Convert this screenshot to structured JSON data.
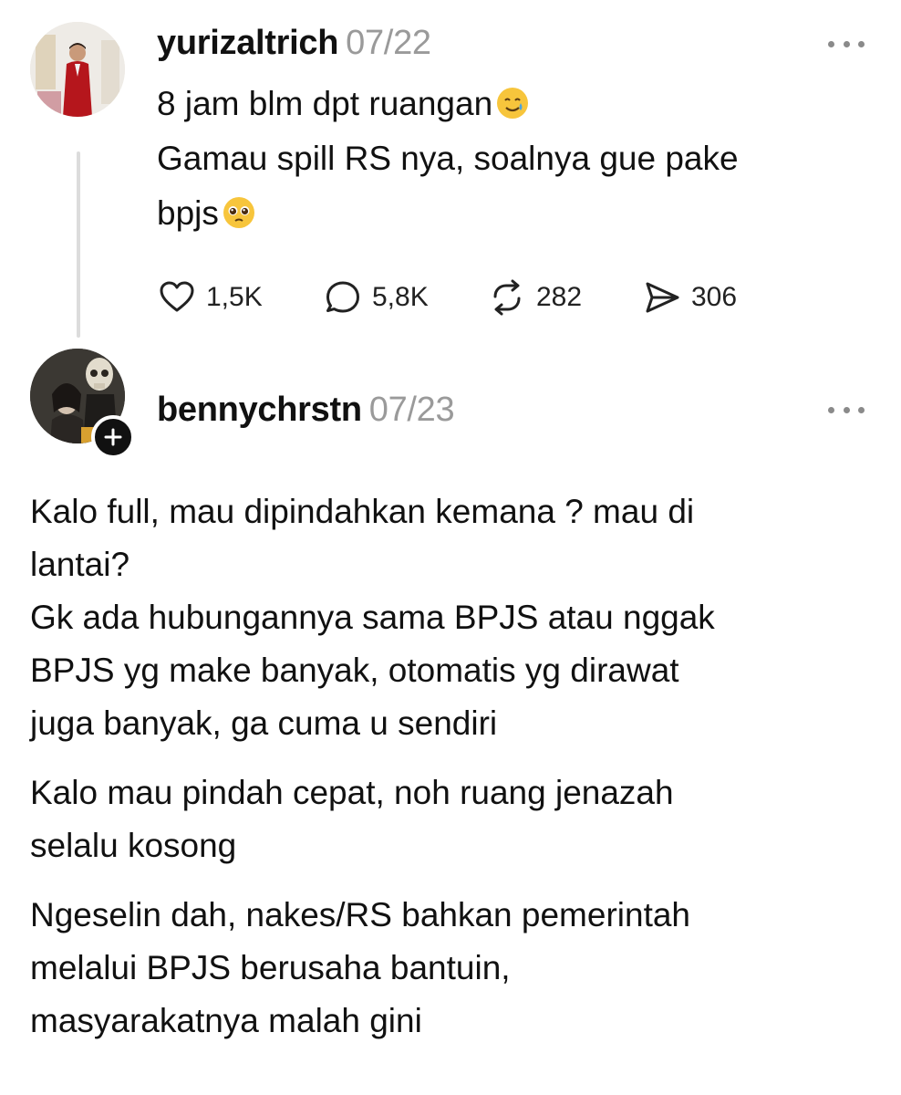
{
  "post1": {
    "username": "yurizaltrich",
    "date": "07/22",
    "lines": [
      "8 jam blm dpt ruangan",
      "Gamau spill RS nya, soalnya gue pake",
      "bpjs"
    ],
    "emoji_line1": "smiling-face-with-tear-icon",
    "emoji_line3": "pleading-face-icon",
    "stats": {
      "likes": "1,5K",
      "replies": "5,8K",
      "reposts": "282",
      "shares": "306"
    }
  },
  "post2": {
    "username": "bennychrstn",
    "date": "07/23",
    "paragraphs": [
      [
        "Kalo full, mau dipindahkan kemana ? mau di",
        "lantai?",
        "Gk ada hubungannya sama BPJS atau nggak",
        "BPJS yg make banyak, otomatis yg dirawat",
        "juga banyak, ga cuma u sendiri"
      ],
      [
        "Kalo mau pindah cepat, noh ruang jenazah",
        "selalu kosong"
      ],
      [
        "Ngeselin dah, nakes/RS bahkan pemerintah",
        "melalui BPJS berusaha bantuin,",
        "masyarakatnya malah gini"
      ]
    ]
  },
  "colors": {
    "text": "#111111",
    "muted": "#9a9a9a",
    "thread_line": "#dcdcdc"
  }
}
